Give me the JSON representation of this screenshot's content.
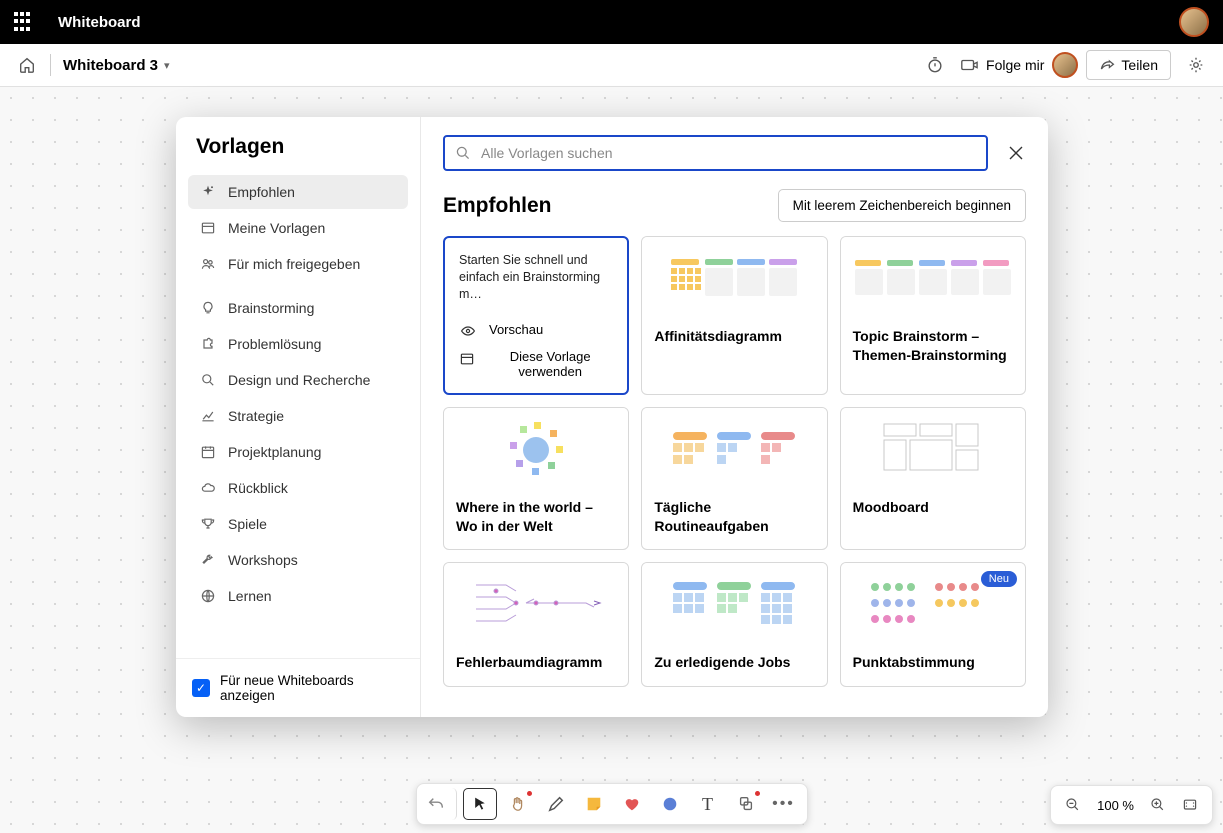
{
  "app": {
    "name": "Whiteboard"
  },
  "header": {
    "board_name": "Whiteboard 3",
    "follow_label": "Folge mir",
    "share_label": "Teilen"
  },
  "dialog": {
    "title": "Vorlagen",
    "search_placeholder": "Alle Vorlagen suchen",
    "show_for_new_label": "Für neue Whiteboards anzeigen",
    "categories": [
      {
        "icon": "sparkle",
        "label": "Empfohlen",
        "active": true
      },
      {
        "icon": "templates",
        "label": "Meine Vorlagen"
      },
      {
        "icon": "shared",
        "label": "Für mich freigegeben"
      },
      {
        "sep": true
      },
      {
        "icon": "bulb",
        "label": "Brainstorming"
      },
      {
        "icon": "puzzle",
        "label": "Problemlösung"
      },
      {
        "icon": "search",
        "label": "Design und Recherche"
      },
      {
        "icon": "chart",
        "label": "Strategie"
      },
      {
        "icon": "calendar",
        "label": "Projektplanung"
      },
      {
        "icon": "cloud",
        "label": "Rückblick"
      },
      {
        "icon": "trophy",
        "label": "Spiele"
      },
      {
        "icon": "wrench",
        "label": "Workshops"
      },
      {
        "icon": "globe",
        "label": "Lernen"
      }
    ],
    "main_title": "Empfohlen",
    "blank_button": "Mit leerem Zeichenbereich beginnen",
    "selected_card": {
      "desc": "Starten Sie schnell und einfach ein Brainstorming m…",
      "preview_label": "Vorschau",
      "use_label": "Diese Vorlage verwenden"
    },
    "templates": [
      {
        "label": "Affinitätsdiagramm"
      },
      {
        "label": "Topic Brainstorm – Themen-Brainstorming"
      },
      {
        "label": "Where in the world – Wo in der Welt"
      },
      {
        "label": "Tägliche Routineaufgaben"
      },
      {
        "label": "Moodboard"
      },
      {
        "label": "Fehlerbaumdiagramm"
      },
      {
        "label": "Zu erledigende Jobs"
      },
      {
        "label": "Punktabstimmung",
        "badge": "Neu"
      }
    ]
  },
  "toolbar": {
    "tools": [
      "undo",
      "pointer",
      "hand",
      "pen",
      "note",
      "heart",
      "shape",
      "text",
      "stamp",
      "more"
    ]
  },
  "zoom": {
    "level": "100 %"
  }
}
